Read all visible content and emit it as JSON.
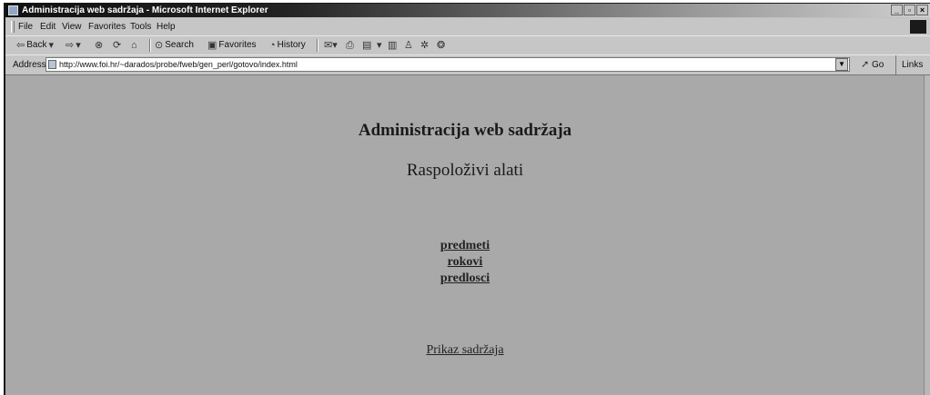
{
  "window": {
    "title": "Administracija web sadržaja - Microsoft Internet Explorer",
    "buttons": [
      "_",
      "▫",
      "×"
    ]
  },
  "menu": [
    "File",
    "Edit",
    "View",
    "Favorites",
    "Tools",
    "Help"
  ],
  "toolbar": {
    "back": "Back",
    "search": "Search",
    "favorites": "Favorites",
    "history": "History"
  },
  "address": {
    "label": "Address",
    "url": "http://www.foi.hr/~darados/probe/fweb/gen_perl/gotovo/index.html",
    "go": "Go",
    "links": "Links"
  },
  "page": {
    "heading": "Administracija web sadržaja",
    "subheading": "Raspoloživi alati",
    "links": [
      "predmeti",
      "rokovi",
      "predlosci"
    ],
    "footer_link": "Prikaz sadržaja"
  },
  "colors": {
    "content_bg": "#a9a9a9",
    "chrome_bg": "#c6c6c6"
  }
}
